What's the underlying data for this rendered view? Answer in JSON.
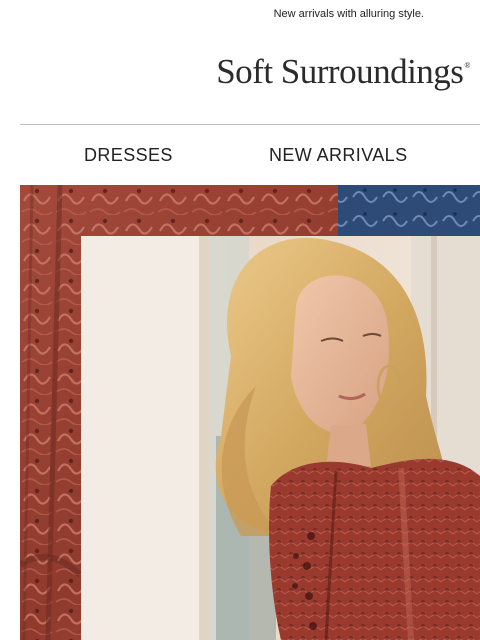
{
  "preheader": {
    "text": "New arrivals with alluring style."
  },
  "brand": {
    "name": "Soft Surroundings",
    "mark": "®"
  },
  "nav": {
    "items": [
      {
        "label": "DRESSES"
      },
      {
        "label": "NEW ARRIVALS"
      }
    ]
  },
  "hero": {
    "colors": {
      "fabric": "#9a4234",
      "fabric_dark": "#6e2a21",
      "blue": "#2e4a76",
      "wall": "#f0e7dc",
      "hair": "#d9b373",
      "skin": "#e7b99b"
    }
  }
}
